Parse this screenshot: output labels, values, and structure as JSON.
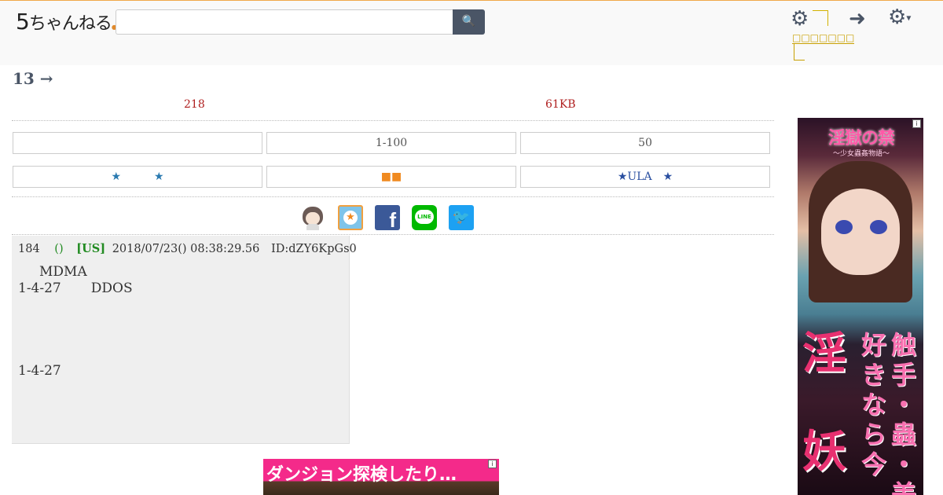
{
  "header": {
    "logo_main": "5",
    "logo_rest": "ちゃんねる",
    "logo_dot": "●",
    "search_placeholder": "",
    "search_icon": "🔍",
    "settings_icon": "⚙",
    "settings_tip": "□□□□□□□",
    "login_icon": "➜",
    "menu_icon": "⚙",
    "menu_caret": "▾"
  },
  "thread": {
    "title": "13 →",
    "res_count": "218",
    "size": "61KB"
  },
  "nav_buttons": [
    {
      "label": ""
    },
    {
      "label": "1-100"
    },
    {
      "label": "50"
    },
    {
      "label": "★　　　★"
    },
    {
      "label": "■■"
    },
    {
      "label": "★ULA　★"
    }
  ],
  "share": {
    "star_glyph": "★",
    "facebook_glyph": "f",
    "line_glyph": "LINE",
    "twitter_glyph": "🐦"
  },
  "post": {
    "number": "184",
    "name": "()",
    "country": "[US]",
    "date": "2018/07/23() 08:38:29.56",
    "id": "ID:dZY6KpGs0",
    "line1": "MDMA",
    "line2_a": "1-4-27",
    "line2_b": "DDOS",
    "line3": "1-4-27"
  },
  "ads": {
    "right_title": "淫獄の禁",
    "right_sub": "～少女蟲姦物語～",
    "right_big1": "淫",
    "right_big2": "妖",
    "right_vt1": "好きなら今",
    "right_vt2": "触手・蟲・美",
    "bottom_text": "ダンジョン探検したり…",
    "info_glyph": "i"
  }
}
